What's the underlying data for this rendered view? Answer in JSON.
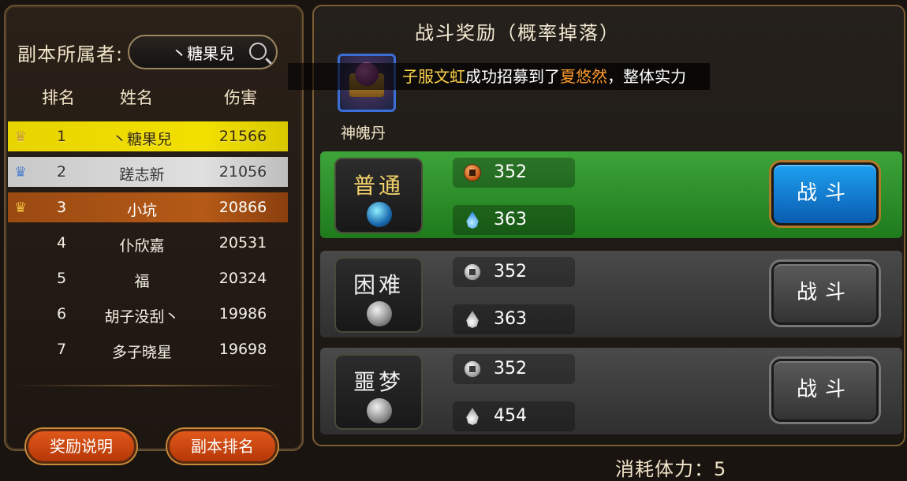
{
  "owner": {
    "label": "副本所属者:",
    "value": "丶糖果兒"
  },
  "table": {
    "headers": [
      "排名",
      "姓名",
      "伤害"
    ],
    "rows": [
      {
        "rank": "1",
        "name": "丶糖果兒",
        "damage": "21566",
        "crown": "gold-crown-icon"
      },
      {
        "rank": "2",
        "name": "蹉志新",
        "damage": "21056",
        "crown": "silver-crown-icon"
      },
      {
        "rank": "3",
        "name": "小坑",
        "damage": "20866",
        "crown": "bronze-crown-icon"
      },
      {
        "rank": "4",
        "name": "仆欣嘉",
        "damage": "20531"
      },
      {
        "rank": "5",
        "name": "福",
        "damage": "20324"
      },
      {
        "rank": "6",
        "name": "胡子没刮丶",
        "damage": "19986"
      },
      {
        "rank": "7",
        "name": "多子晓星",
        "damage": "19698"
      }
    ]
  },
  "buttons": {
    "reward_info": "奖励说明",
    "dungeon_rank": "副本排名"
  },
  "reward": {
    "title": "战斗奖励（概率掉落）",
    "item_name": "神魄丹"
  },
  "broadcast": {
    "player": "子服文虹",
    "mid": "成功招募到了",
    "hero": "夏悠然",
    "tail": "，整体实力"
  },
  "difficulties": [
    {
      "label": "普通",
      "coin": "352",
      "water": "363",
      "fight": "战斗",
      "selected": true
    },
    {
      "label": "困难",
      "coin": "352",
      "water": "363",
      "fight": "战斗",
      "selected": false
    },
    {
      "label": "噩梦",
      "coin": "352",
      "water": "454",
      "fight": "战斗",
      "selected": false
    }
  ],
  "stamina": "消耗体力：5",
  "colors": {
    "gold_row": "#f2e000",
    "silver_row": "#e0e0e0",
    "bronze_row": "#b55a18",
    "normal_green": "#3da43a",
    "fight_blue": "#1ea0f0"
  }
}
